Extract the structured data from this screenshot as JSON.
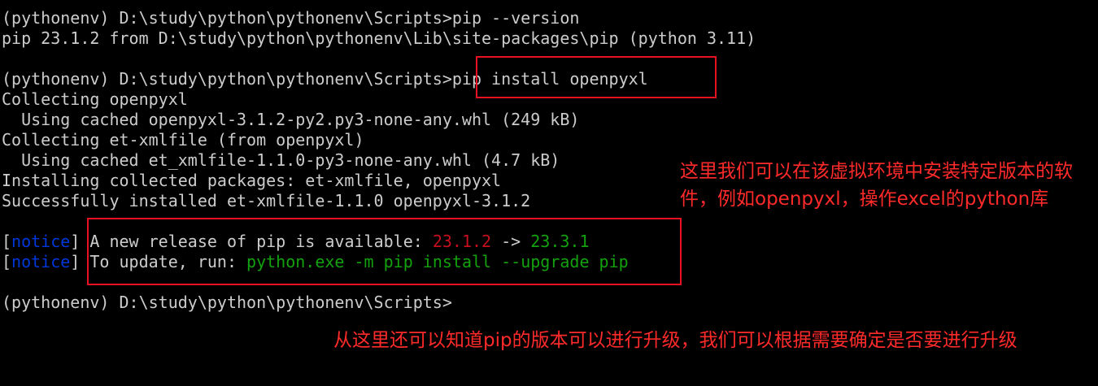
{
  "terminal": {
    "lines": [
      "(pythonenv) D:\\study\\python\\pythonenv\\Scripts>pip --version",
      "pip 23.1.2 from D:\\study\\python\\pythonenv\\Lib\\site-packages\\pip (python 3.11)",
      "",
      "(pythonenv) D:\\study\\python\\pythonenv\\Scripts>pip install openpyxl",
      "Collecting openpyxl",
      "  Using cached openpyxl-3.1.2-py2.py3-none-any.whl (249 kB)",
      "Collecting et-xmlfile (from openpyxl)",
      "  Using cached et_xmlfile-1.1.0-py3-none-any.whl (4.7 kB)",
      "Installing collected packages: et-xmlfile, openpyxl",
      "Successfully installed et-xmlfile-1.1.0 openpyxl-3.1.2"
    ],
    "notice_1": {
      "open_bracket": "[",
      "tag": "notice",
      "close_bracket": "]",
      "text": " A new release of pip is available: ",
      "old_version": "23.1.2",
      "arrow": " -> ",
      "new_version": "23.3.1"
    },
    "notice_2": {
      "open_bracket": "[",
      "tag": "notice",
      "close_bracket": "]",
      "text": " To update, run: ",
      "command": "python.exe -m pip install --upgrade pip"
    },
    "prompt": "(pythonenv) D:\\study\\python\\pythonenv\\Scripts>"
  },
  "annotations": {
    "install_note": "这里我们可以在该虚拟环境中安装特定版本的软件，例如openpyxl，操作excel的python库",
    "upgrade_note": "从这里还可以知道pip的版本可以进行升级，我们可以根据需要确定是否要进行升级"
  },
  "colors": {
    "background": "#000000",
    "text": "#cccccc",
    "old_version": "#c50f1f",
    "new_version": "#13a10e",
    "notice_tag": "#0037da",
    "highlight_box": "#e81123",
    "annotation": "#ff2a2a"
  }
}
